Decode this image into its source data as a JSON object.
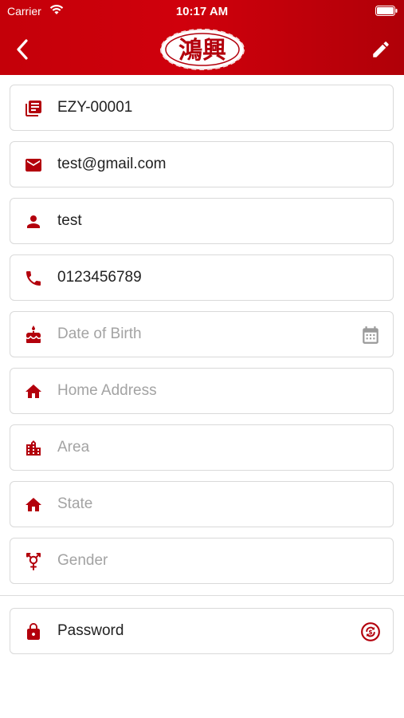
{
  "status_bar": {
    "carrier": "Carrier",
    "time": "10:17 AM"
  },
  "nav": {
    "logo_text": "鴻興"
  },
  "fields": [
    {
      "value": "EZY-00001",
      "placeholder": "",
      "icon": "member-id-icon"
    },
    {
      "value": "test@gmail.com",
      "placeholder": "",
      "icon": "email-icon"
    },
    {
      "value": "test",
      "placeholder": "",
      "icon": "person-icon"
    },
    {
      "value": "0123456789",
      "placeholder": "",
      "icon": "phone-icon"
    },
    {
      "value": "",
      "placeholder": "Date of Birth",
      "icon": "cake-icon",
      "trailing_icon": "calendar-icon"
    },
    {
      "value": "",
      "placeholder": "Home Address",
      "icon": "home-icon"
    },
    {
      "value": "",
      "placeholder": "Area",
      "icon": "city-icon"
    },
    {
      "value": "",
      "placeholder": "State",
      "icon": "home-icon"
    },
    {
      "value": "",
      "placeholder": "Gender",
      "icon": "gender-icon"
    }
  ],
  "password": {
    "label": "Password",
    "icon": "lock-icon",
    "trailing_icon": "reset-password-icon"
  },
  "colors": {
    "brand_red": "#c8000a",
    "icon_red": "#b3000c",
    "placeholder": "#a3a3a3",
    "border": "#d9d9d9"
  }
}
